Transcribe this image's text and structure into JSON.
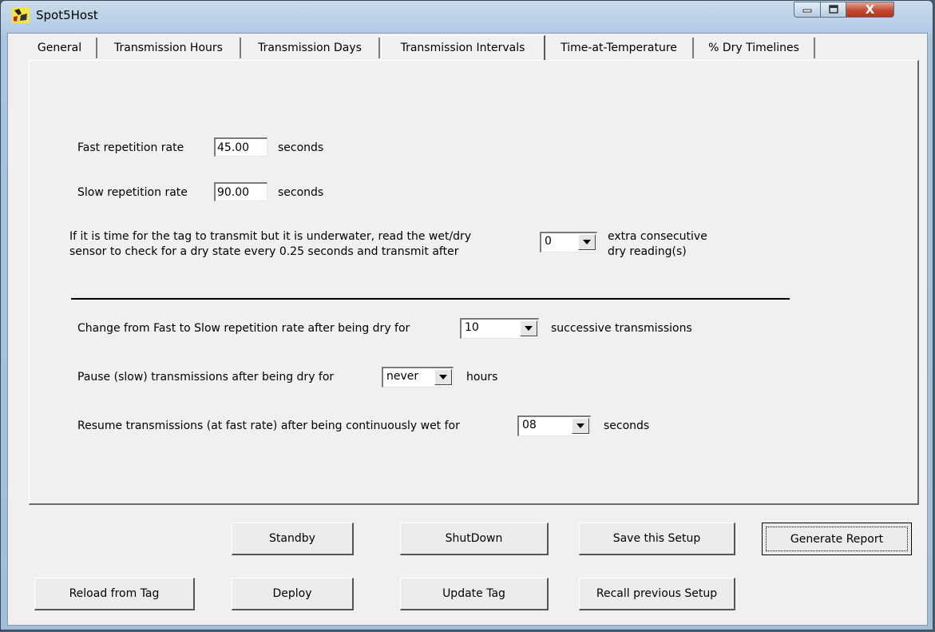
{
  "window": {
    "title": "Spot5Host",
    "controls": {
      "close": "X"
    }
  },
  "tabs": [
    {
      "label": "General"
    },
    {
      "label": "Transmission Hours"
    },
    {
      "label": "Transmission Days"
    },
    {
      "label": "Transmission Intervals",
      "active": true
    },
    {
      "label": "Time-at-Temperature"
    },
    {
      "label": "% Dry Timelines"
    }
  ],
  "intervals": {
    "fast": {
      "label": "Fast repetition rate",
      "value": "45.00",
      "unit": "seconds"
    },
    "slow": {
      "label": "Slow repetition rate",
      "value": "90.00",
      "unit": "seconds"
    },
    "underwater": {
      "text_line1": "If it is time for the tag to transmit but it is underwater, read the wet/dry",
      "text_line2": "sensor to check for a dry state every 0.25 seconds and transmit after",
      "value": "0",
      "suffix_line1": "extra consecutive",
      "suffix_line2": "dry reading(s)"
    },
    "fast_to_slow": {
      "label": "Change from Fast to Slow repetition rate after being dry for",
      "value": "10",
      "suffix": "successive transmissions"
    },
    "pause": {
      "label": "Pause (slow) transmissions after being dry for",
      "value": "never",
      "suffix": "hours"
    },
    "resume": {
      "label": "Resume transmissions (at fast rate) after being continuously wet for",
      "value": "08",
      "suffix": "seconds"
    }
  },
  "buttons": {
    "standby": "Standby",
    "shutdown": "ShutDown",
    "save_setup": "Save this Setup",
    "generate_report": "Generate Report",
    "reload": "Reload from Tag",
    "deploy": "Deploy",
    "update_tag": "Update Tag",
    "recall_setup": "Recall previous Setup"
  },
  "colors": {
    "client_bg": "#f0f0f0",
    "titlebar": "#b7cfe6",
    "close_button": "#c24a33"
  },
  "icons": [
    "app-icon",
    "minimize-icon",
    "maximize-icon",
    "close-icon",
    "chevron-down-icon"
  ]
}
